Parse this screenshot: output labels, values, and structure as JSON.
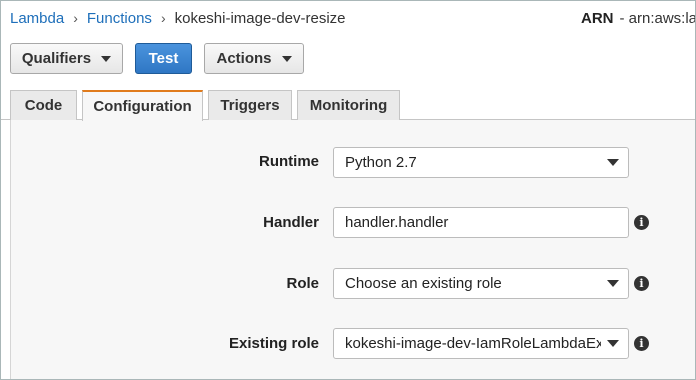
{
  "breadcrumb": {
    "items": [
      "Lambda",
      "Functions"
    ],
    "current": "kokeshi-image-dev-resize",
    "separator": "›"
  },
  "arn": {
    "label": "ARN",
    "value": "- arn:aws:lam"
  },
  "toolbar": {
    "qualifiers_label": "Qualifiers",
    "test_label": "Test",
    "actions_label": "Actions"
  },
  "tabs": [
    {
      "label": "Code",
      "active": false
    },
    {
      "label": "Configuration",
      "active": true
    },
    {
      "label": "Triggers",
      "active": false
    },
    {
      "label": "Monitoring",
      "active": false
    }
  ],
  "form": {
    "runtime": {
      "label": "Runtime",
      "value": "Python 2.7",
      "type": "select"
    },
    "handler": {
      "label": "Handler",
      "value": "handler.handler",
      "type": "input"
    },
    "role": {
      "label": "Role",
      "value": "Choose an existing role",
      "type": "select"
    },
    "existing_role": {
      "label": "Existing role",
      "value": "kokeshi-image-dev-IamRoleLambdaExecution",
      "type": "select"
    }
  },
  "icons": {
    "info": "info-icon",
    "dropdown": "caret-down-icon"
  },
  "colors": {
    "link": "#1e6fba",
    "primary_button": "#2f77c4",
    "active_tab_accent": "#e07b1c"
  }
}
